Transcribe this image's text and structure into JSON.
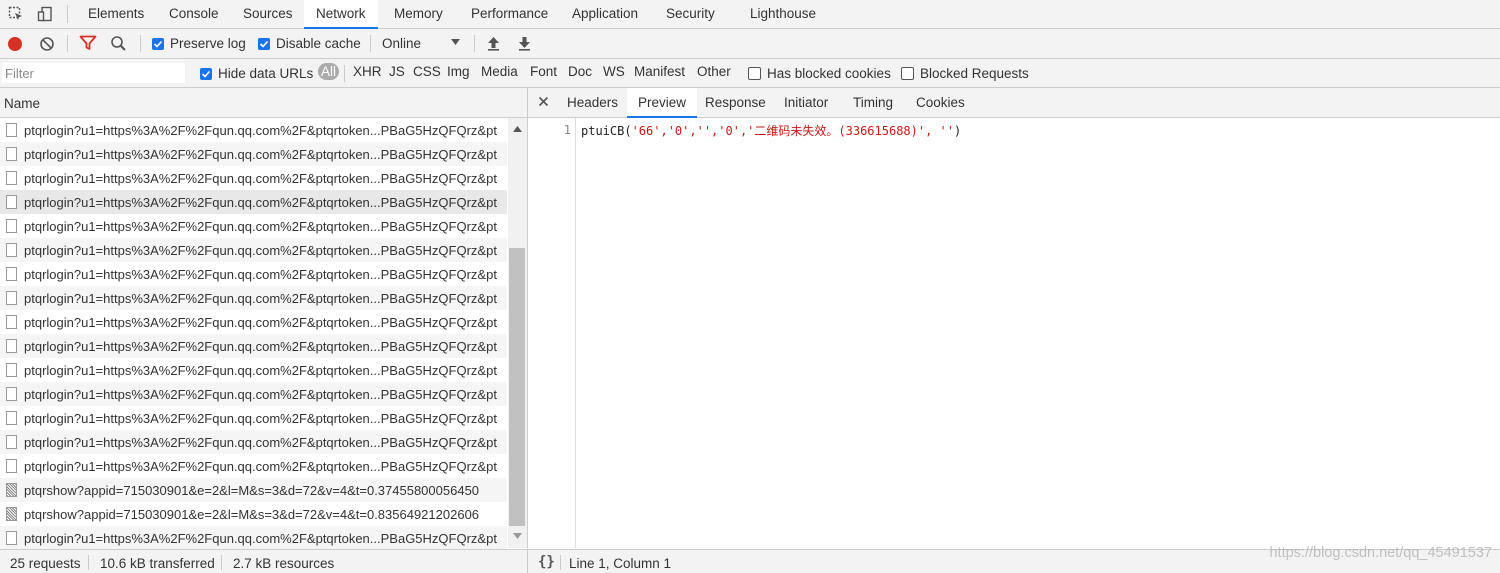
{
  "tabs": [
    "Elements",
    "Console",
    "Sources",
    "Network",
    "Memory",
    "Performance",
    "Application",
    "Security",
    "Lighthouse"
  ],
  "toolbar": {
    "preserve_log": "Preserve log",
    "disable_cache": "Disable cache",
    "throttle": "Online"
  },
  "filterbar": {
    "placeholder": "Filter",
    "hide_data_urls": "Hide data URLs",
    "types": [
      "All",
      "XHR",
      "JS",
      "CSS",
      "Img",
      "Media",
      "Font",
      "Doc",
      "WS",
      "Manifest",
      "Other"
    ],
    "has_blocked_cookies": "Has blocked cookies",
    "blocked_requests": "Blocked Requests"
  },
  "list": {
    "header": "Name",
    "rows": [
      {
        "name": "ptqrlogin?u1=https%3A%2F%2Fqun.qq.com%2F&ptqrtoken...PBaG5HzQFQrz&pt",
        "icon": "doc"
      },
      {
        "name": "ptqrlogin?u1=https%3A%2F%2Fqun.qq.com%2F&ptqrtoken...PBaG5HzQFQrz&pt",
        "icon": "doc"
      },
      {
        "name": "ptqrlogin?u1=https%3A%2F%2Fqun.qq.com%2F&ptqrtoken...PBaG5HzQFQrz&pt",
        "icon": "doc"
      },
      {
        "name": "ptqrlogin?u1=https%3A%2F%2Fqun.qq.com%2F&ptqrtoken...PBaG5HzQFQrz&pt",
        "icon": "doc"
      },
      {
        "name": "ptqrlogin?u1=https%3A%2F%2Fqun.qq.com%2F&ptqrtoken...PBaG5HzQFQrz&pt",
        "icon": "doc"
      },
      {
        "name": "ptqrlogin?u1=https%3A%2F%2Fqun.qq.com%2F&ptqrtoken...PBaG5HzQFQrz&pt",
        "icon": "doc"
      },
      {
        "name": "ptqrlogin?u1=https%3A%2F%2Fqun.qq.com%2F&ptqrtoken...PBaG5HzQFQrz&pt",
        "icon": "doc"
      },
      {
        "name": "ptqrlogin?u1=https%3A%2F%2Fqun.qq.com%2F&ptqrtoken...PBaG5HzQFQrz&pt",
        "icon": "doc"
      },
      {
        "name": "ptqrlogin?u1=https%3A%2F%2Fqun.qq.com%2F&ptqrtoken...PBaG5HzQFQrz&pt",
        "icon": "doc"
      },
      {
        "name": "ptqrlogin?u1=https%3A%2F%2Fqun.qq.com%2F&ptqrtoken...PBaG5HzQFQrz&pt",
        "icon": "doc"
      },
      {
        "name": "ptqrlogin?u1=https%3A%2F%2Fqun.qq.com%2F&ptqrtoken...PBaG5HzQFQrz&pt",
        "icon": "doc"
      },
      {
        "name": "ptqrlogin?u1=https%3A%2F%2Fqun.qq.com%2F&ptqrtoken...PBaG5HzQFQrz&pt",
        "icon": "doc"
      },
      {
        "name": "ptqrlogin?u1=https%3A%2F%2Fqun.qq.com%2F&ptqrtoken...PBaG5HzQFQrz&pt",
        "icon": "doc"
      },
      {
        "name": "ptqrlogin?u1=https%3A%2F%2Fqun.qq.com%2F&ptqrtoken...PBaG5HzQFQrz&pt",
        "icon": "doc"
      },
      {
        "name": "ptqrlogin?u1=https%3A%2F%2Fqun.qq.com%2F&ptqrtoken...PBaG5HzQFQrz&pt",
        "icon": "doc"
      },
      {
        "name": "ptqrshow?appid=715030901&e=2&l=M&s=3&d=72&v=4&t=0.37455800056450",
        "icon": "img"
      },
      {
        "name": "ptqrshow?appid=715030901&e=2&l=M&s=3&d=72&v=4&t=0.83564921202606",
        "icon": "img"
      },
      {
        "name": "ptqrlogin?u1=https%3A%2F%2Fqun.qq.com%2F&ptqrtoken...PBaG5HzQFQrz&pt",
        "icon": "doc"
      }
    ]
  },
  "status": {
    "requests": "25 requests",
    "transferred": "10.6 kB transferred",
    "resources": "2.7 kB resources"
  },
  "detail": {
    "tabs": [
      "Headers",
      "Preview",
      "Response",
      "Initiator",
      "Timing",
      "Cookies"
    ],
    "line_number": "1",
    "code_fn": "ptuiCB(",
    "code_args": "'66','0','','0','二维码未失效。(336615688)', ''",
    "code_close": ")",
    "position": "Line 1, Column 1",
    "braces": "{}"
  },
  "watermark": "https://blog.csdn.net/qq_45491537",
  "colors": {
    "accent": "#1a73e8",
    "record": "#d93025",
    "filter_active": "#d93025",
    "string": "#c41a16"
  }
}
